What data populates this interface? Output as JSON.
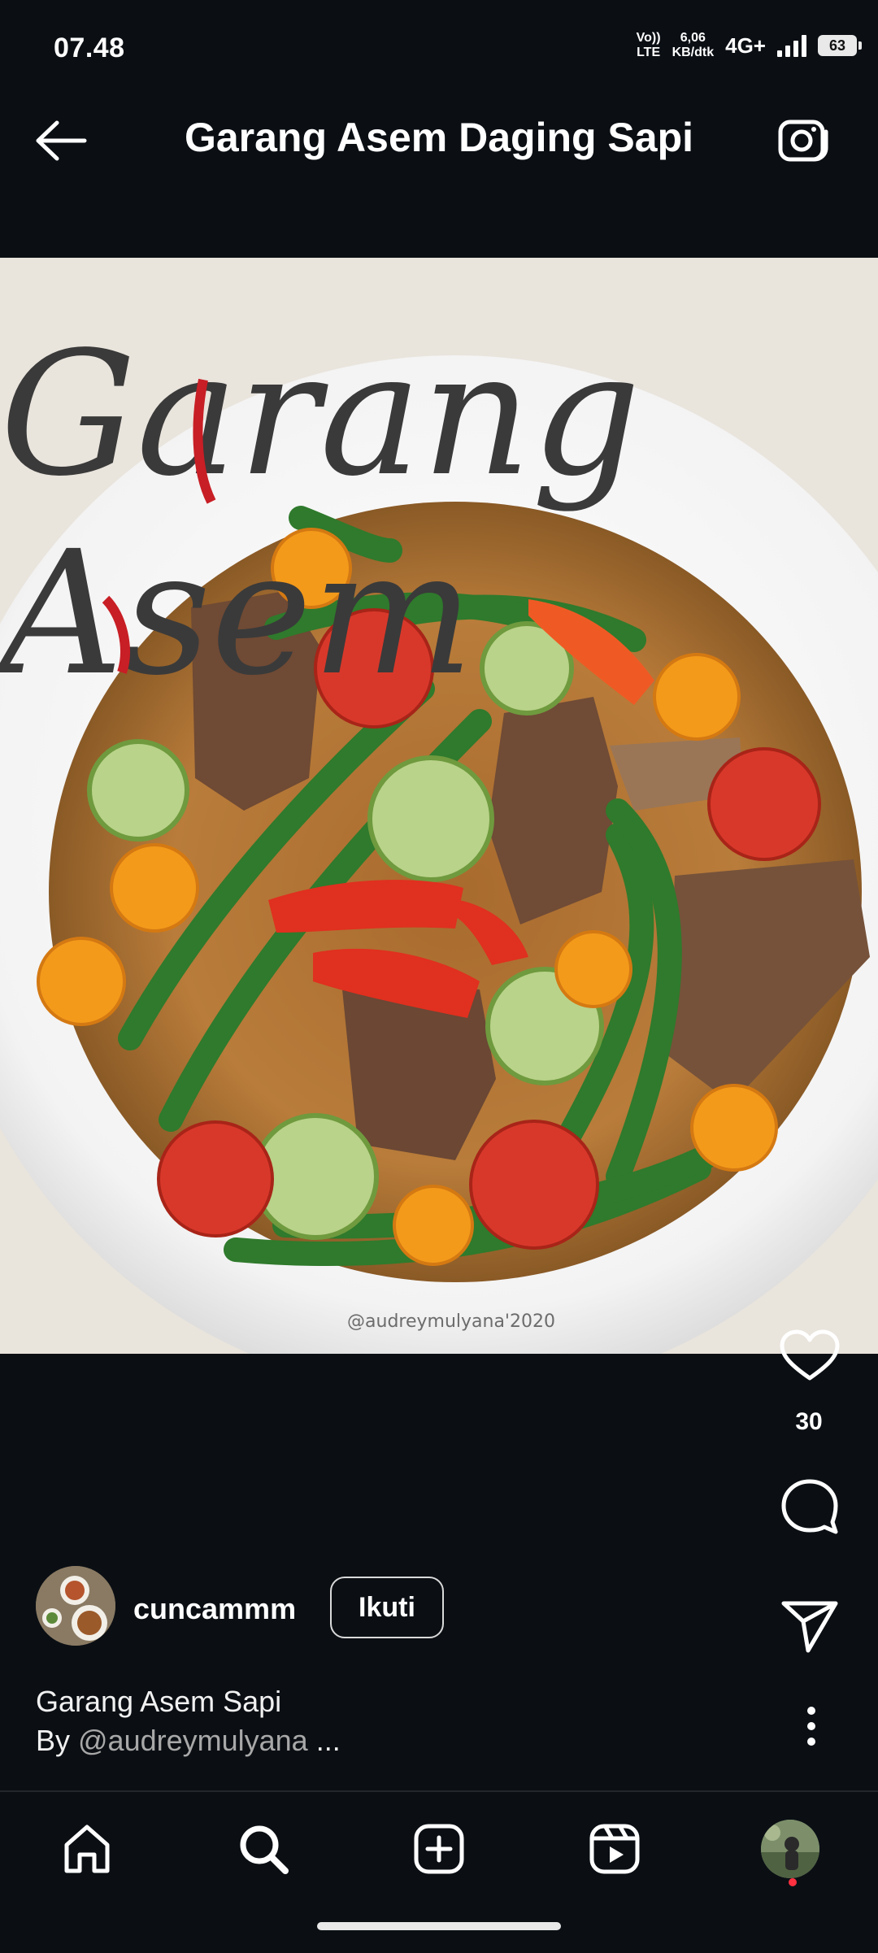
{
  "status_bar": {
    "time": "07.48",
    "volte": "Vo))",
    "lte": "LTE",
    "speed_value": "6,06",
    "speed_unit": "KB/dtk",
    "network": "4G+",
    "battery": "63"
  },
  "header": {
    "title": "Garang Asem Daging Sapi"
  },
  "post": {
    "image_overlay_title_line1": "Garang",
    "image_overlay_title_line2": "Asem",
    "watermark": "@audreymulyana'2020",
    "like_count": "30"
  },
  "author": {
    "username": "cuncammm",
    "follow_label": "Ikuti"
  },
  "caption": {
    "title": "Garang Asem Sapi",
    "by_prefix": "By ",
    "mention": "@audreymulyana",
    "ellipsis": " ..."
  },
  "bottom_nav": {
    "items": [
      "home-icon",
      "search-icon",
      "create-icon",
      "reels-icon",
      "profile-avatar"
    ]
  },
  "colors": {
    "background": "#0b0f14",
    "accent_red": "#ff3040",
    "text_primary": "#ffffff",
    "text_secondary": "#a8a8a8"
  }
}
